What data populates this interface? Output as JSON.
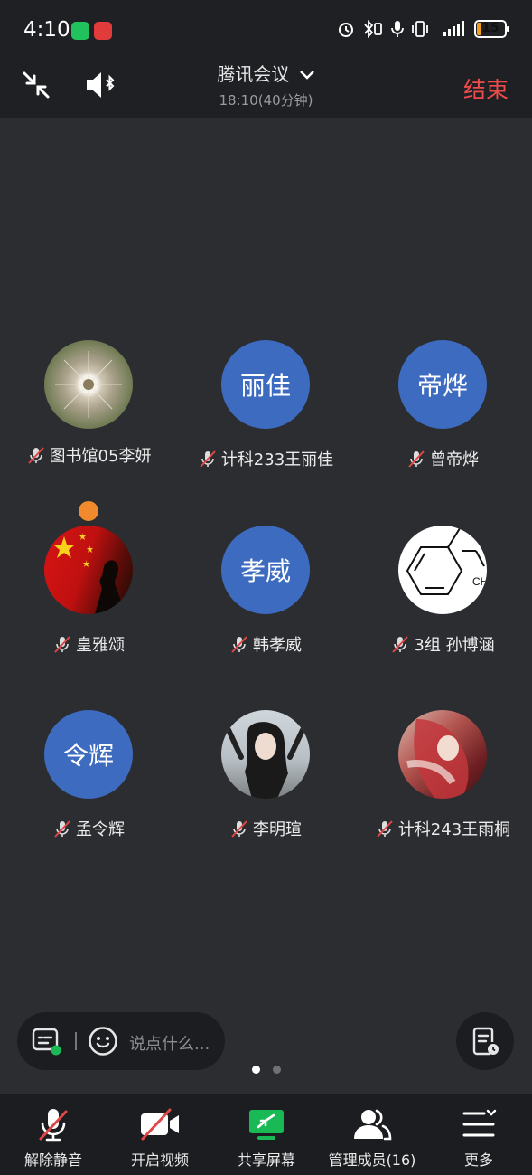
{
  "status_bar": {
    "time": "4:10",
    "battery": "15"
  },
  "header": {
    "title": "腾讯会议",
    "subtitle": "18:10(40分钟)",
    "end_label": "结束"
  },
  "participants": [
    {
      "name": "图书馆05李妍",
      "avatar_text": "",
      "avatar": "dandelion-photo",
      "host": true
    },
    {
      "name": "计科233王丽佳",
      "avatar_text": "丽佳",
      "avatar": "blue"
    },
    {
      "name": "曾帝烨",
      "avatar_text": "帝烨",
      "avatar": "blue"
    },
    {
      "name": "皇雅颂",
      "avatar_text": "",
      "avatar": "flag-photo"
    },
    {
      "name": "韩孝威",
      "avatar_text": "孝威",
      "avatar": "blue"
    },
    {
      "name": "3组 孙博涵",
      "avatar_text": "",
      "avatar": "molecule-drawing",
      "molecule_label": "CH"
    },
    {
      "name": "孟令辉",
      "avatar_text": "令辉",
      "avatar": "blue"
    },
    {
      "name": "李明瑄",
      "avatar_text": "",
      "avatar": "portrait-photo"
    },
    {
      "name": "计科243王雨桐",
      "avatar_text": "",
      "avatar": "anime-photo"
    }
  ],
  "chat": {
    "placeholder": "说点什么..."
  },
  "pager": {
    "pages": 2,
    "current": 1
  },
  "toolbar": {
    "unmute_label": "解除静音",
    "video_label": "开启视频",
    "share_label": "共享屏幕",
    "members_label": "管理成员(16)",
    "more_label": "更多"
  },
  "colors": {
    "accent_blue": "#3d6bc0",
    "end_red": "#ef4b4b",
    "share_green": "#19b955",
    "host_orange": "#f08a2c"
  }
}
